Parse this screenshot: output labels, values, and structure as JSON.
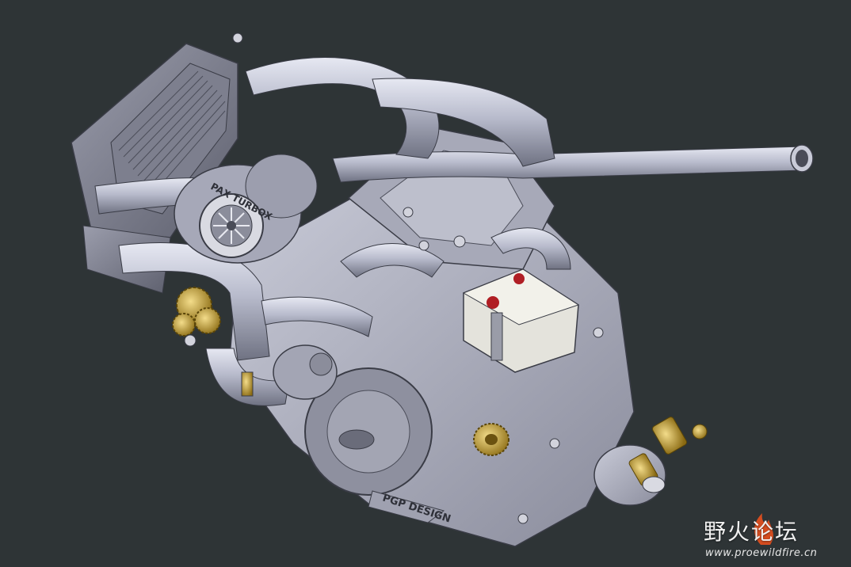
{
  "scene": {
    "subject_icon": "engine-model-icon",
    "turbo_label": "PAX TURBOX",
    "crankcase_label": "PGP DESIGN",
    "background_color": "#2e3436",
    "part_color": "#b4b6c6",
    "accent_color": "#c9a227"
  },
  "watermark": {
    "title": "野火论坛",
    "url": "www.proewildfire.cn",
    "flame_color": "#e8501e"
  }
}
